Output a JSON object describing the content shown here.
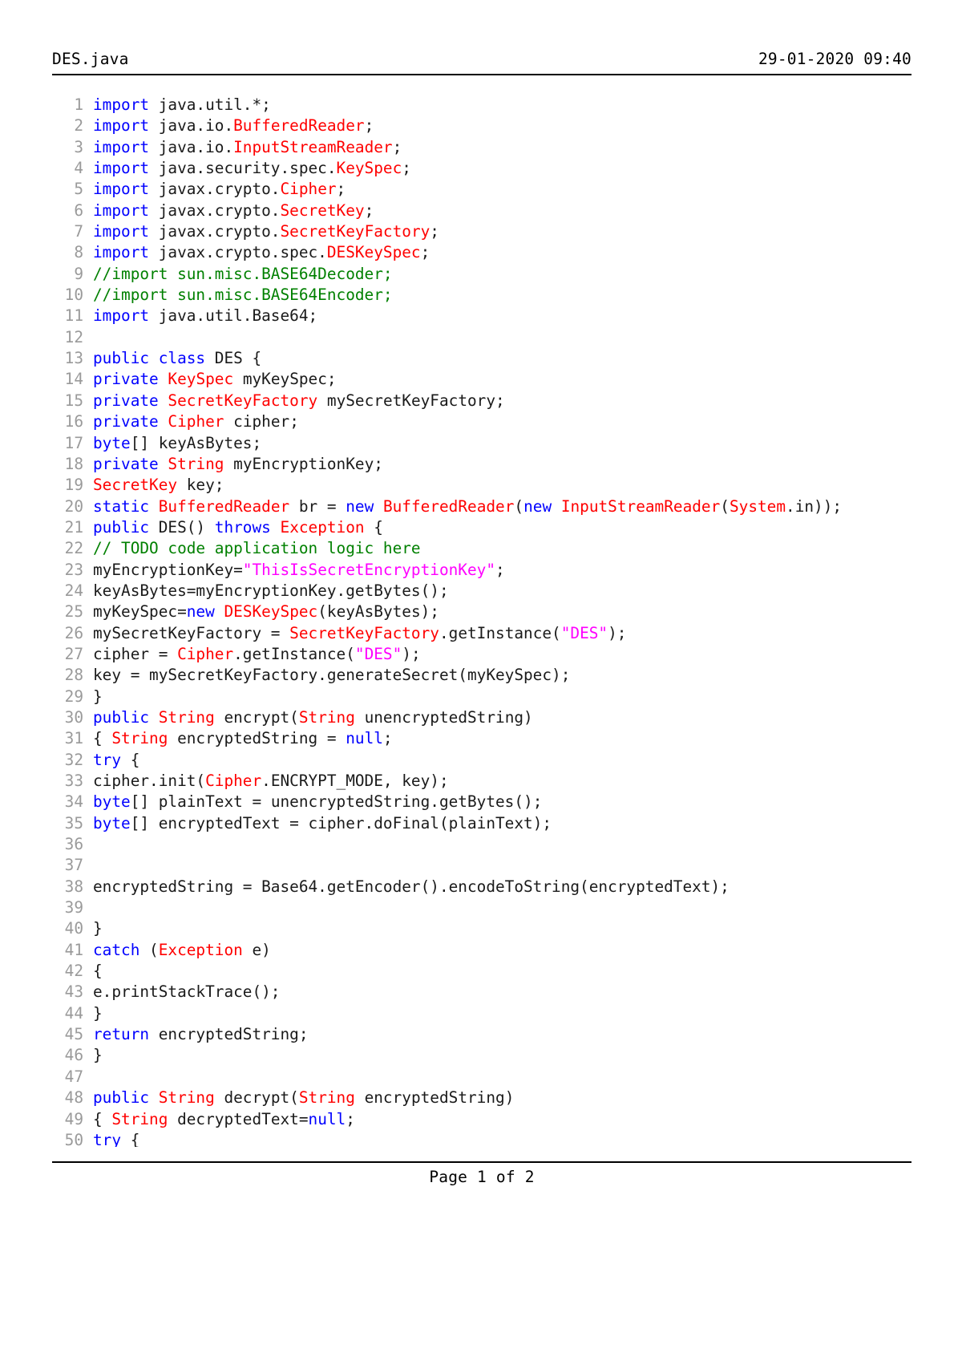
{
  "document": {
    "header": {
      "filename": "DES.java",
      "date": "29-01-2020",
      "time": "09:40",
      "datetime": "29-01-2020 09:40"
    },
    "footer": {
      "page_label": "Page 1 of 2",
      "current_page": 1,
      "total_pages": 2
    },
    "syntax_colors": {
      "keyword": "#0000ff",
      "class_name": "#ff0000",
      "string": "#ff00ff",
      "comment": "#008000",
      "plain": "#1a1a1a",
      "line_number": "#9a9a9a",
      "background": "#ffffff",
      "rule": "#000000"
    },
    "code_lines": [
      {
        "n": "1",
        "tokens": [
          {
            "t": "import",
            "c": "kw"
          },
          {
            "t": " java.util.*;",
            "c": "pln"
          }
        ]
      },
      {
        "n": "2",
        "tokens": [
          {
            "t": "import",
            "c": "kw"
          },
          {
            "t": " java.io.",
            "c": "pln"
          },
          {
            "t": "BufferedReader",
            "c": "cls"
          },
          {
            "t": ";",
            "c": "pln"
          }
        ]
      },
      {
        "n": "3",
        "tokens": [
          {
            "t": "import",
            "c": "kw"
          },
          {
            "t": " java.io.",
            "c": "pln"
          },
          {
            "t": "InputStreamReader",
            "c": "cls"
          },
          {
            "t": ";",
            "c": "pln"
          }
        ]
      },
      {
        "n": "4",
        "tokens": [
          {
            "t": "import",
            "c": "kw"
          },
          {
            "t": " java.security.spec.",
            "c": "pln"
          },
          {
            "t": "KeySpec",
            "c": "cls"
          },
          {
            "t": ";",
            "c": "pln"
          }
        ]
      },
      {
        "n": "5",
        "tokens": [
          {
            "t": "import",
            "c": "kw"
          },
          {
            "t": " javax.crypto.",
            "c": "pln"
          },
          {
            "t": "Cipher",
            "c": "cls"
          },
          {
            "t": ";",
            "c": "pln"
          }
        ]
      },
      {
        "n": "6",
        "tokens": [
          {
            "t": "import",
            "c": "kw"
          },
          {
            "t": " javax.crypto.",
            "c": "pln"
          },
          {
            "t": "SecretKey",
            "c": "cls"
          },
          {
            "t": ";",
            "c": "pln"
          }
        ]
      },
      {
        "n": "7",
        "tokens": [
          {
            "t": "import",
            "c": "kw"
          },
          {
            "t": " javax.crypto.",
            "c": "pln"
          },
          {
            "t": "SecretKeyFactory",
            "c": "cls"
          },
          {
            "t": ";",
            "c": "pln"
          }
        ]
      },
      {
        "n": "8",
        "tokens": [
          {
            "t": "import",
            "c": "kw"
          },
          {
            "t": " javax.crypto.spec.",
            "c": "pln"
          },
          {
            "t": "DESKeySpec",
            "c": "cls"
          },
          {
            "t": ";",
            "c": "pln"
          }
        ]
      },
      {
        "n": "9",
        "tokens": [
          {
            "t": "//import sun.misc.BASE64Decoder;",
            "c": "cmt"
          }
        ]
      },
      {
        "n": "10",
        "tokens": [
          {
            "t": "//import sun.misc.BASE64Encoder;",
            "c": "cmt"
          }
        ]
      },
      {
        "n": "11",
        "tokens": [
          {
            "t": "import",
            "c": "kw"
          },
          {
            "t": " java.util.Base64;",
            "c": "pln"
          }
        ]
      },
      {
        "n": "12",
        "tokens": []
      },
      {
        "n": "13",
        "tokens": [
          {
            "t": "public class",
            "c": "kw"
          },
          {
            "t": " DES {",
            "c": "pln"
          }
        ]
      },
      {
        "n": "14",
        "tokens": [
          {
            "t": "private",
            "c": "kw"
          },
          {
            "t": " ",
            "c": "pln"
          },
          {
            "t": "KeySpec",
            "c": "cls"
          },
          {
            "t": " myKeySpec;",
            "c": "pln"
          }
        ]
      },
      {
        "n": "15",
        "tokens": [
          {
            "t": "private",
            "c": "kw"
          },
          {
            "t": " ",
            "c": "pln"
          },
          {
            "t": "SecretKeyFactory",
            "c": "cls"
          },
          {
            "t": " mySecretKeyFactory;",
            "c": "pln"
          }
        ]
      },
      {
        "n": "16",
        "tokens": [
          {
            "t": "private",
            "c": "kw"
          },
          {
            "t": " ",
            "c": "pln"
          },
          {
            "t": "Cipher",
            "c": "cls"
          },
          {
            "t": " cipher;",
            "c": "pln"
          }
        ]
      },
      {
        "n": "17",
        "tokens": [
          {
            "t": "byte",
            "c": "kw"
          },
          {
            "t": "[] keyAsBytes;",
            "c": "pln"
          }
        ]
      },
      {
        "n": "18",
        "tokens": [
          {
            "t": "private",
            "c": "kw"
          },
          {
            "t": " ",
            "c": "pln"
          },
          {
            "t": "String",
            "c": "cls"
          },
          {
            "t": " myEncryptionKey;",
            "c": "pln"
          }
        ]
      },
      {
        "n": "19",
        "tokens": [
          {
            "t": "SecretKey",
            "c": "cls"
          },
          {
            "t": " key;",
            "c": "pln"
          }
        ]
      },
      {
        "n": "20",
        "tokens": [
          {
            "t": "static",
            "c": "kw"
          },
          {
            "t": " ",
            "c": "pln"
          },
          {
            "t": "BufferedReader",
            "c": "cls"
          },
          {
            "t": " br = ",
            "c": "pln"
          },
          {
            "t": "new",
            "c": "kw"
          },
          {
            "t": " ",
            "c": "pln"
          },
          {
            "t": "BufferedReader",
            "c": "cls"
          },
          {
            "t": "(",
            "c": "pln"
          },
          {
            "t": "new",
            "c": "kw"
          },
          {
            "t": " ",
            "c": "pln"
          },
          {
            "t": "InputStreamReader",
            "c": "cls"
          },
          {
            "t": "(",
            "c": "pln"
          },
          {
            "t": "System",
            "c": "cls"
          },
          {
            "t": ".in));",
            "c": "pln"
          }
        ]
      },
      {
        "n": "21",
        "tokens": [
          {
            "t": "public",
            "c": "kw"
          },
          {
            "t": " DES() ",
            "c": "pln"
          },
          {
            "t": "throws",
            "c": "kw"
          },
          {
            "t": " ",
            "c": "pln"
          },
          {
            "t": "Exception",
            "c": "cls"
          },
          {
            "t": " {",
            "c": "pln"
          }
        ]
      },
      {
        "n": "22",
        "tokens": [
          {
            "t": "// TODO code application logic here",
            "c": "cmt"
          }
        ]
      },
      {
        "n": "23",
        "tokens": [
          {
            "t": "myEncryptionKey=",
            "c": "pln"
          },
          {
            "t": "\"ThisIsSecretEncryptionKey\"",
            "c": "str"
          },
          {
            "t": ";",
            "c": "pln"
          }
        ]
      },
      {
        "n": "24",
        "tokens": [
          {
            "t": "keyAsBytes=myEncryptionKey.getBytes();",
            "c": "pln"
          }
        ]
      },
      {
        "n": "25",
        "tokens": [
          {
            "t": "myKeySpec=",
            "c": "pln"
          },
          {
            "t": "new",
            "c": "kw"
          },
          {
            "t": " ",
            "c": "pln"
          },
          {
            "t": "DESKeySpec",
            "c": "cls"
          },
          {
            "t": "(keyAsBytes);",
            "c": "pln"
          }
        ]
      },
      {
        "n": "26",
        "tokens": [
          {
            "t": "mySecretKeyFactory = ",
            "c": "pln"
          },
          {
            "t": "SecretKeyFactory",
            "c": "cls"
          },
          {
            "t": ".getInstance(",
            "c": "pln"
          },
          {
            "t": "\"DES\"",
            "c": "str"
          },
          {
            "t": ");",
            "c": "pln"
          }
        ]
      },
      {
        "n": "27",
        "tokens": [
          {
            "t": "cipher = ",
            "c": "pln"
          },
          {
            "t": "Cipher",
            "c": "cls"
          },
          {
            "t": ".getInstance(",
            "c": "pln"
          },
          {
            "t": "\"DES\"",
            "c": "str"
          },
          {
            "t": ");",
            "c": "pln"
          }
        ]
      },
      {
        "n": "28",
        "tokens": [
          {
            "t": "key = mySecretKeyFactory.generateSecret(myKeySpec);",
            "c": "pln"
          }
        ]
      },
      {
        "n": "29",
        "tokens": [
          {
            "t": "}",
            "c": "pln"
          }
        ]
      },
      {
        "n": "30",
        "tokens": [
          {
            "t": "public",
            "c": "kw"
          },
          {
            "t": " ",
            "c": "pln"
          },
          {
            "t": "String",
            "c": "cls"
          },
          {
            "t": " encrypt(",
            "c": "pln"
          },
          {
            "t": "String",
            "c": "cls"
          },
          {
            "t": " unencryptedString)",
            "c": "pln"
          }
        ]
      },
      {
        "n": "31",
        "tokens": [
          {
            "t": "{ ",
            "c": "pln"
          },
          {
            "t": "String",
            "c": "cls"
          },
          {
            "t": " encryptedString = ",
            "c": "pln"
          },
          {
            "t": "null",
            "c": "kw"
          },
          {
            "t": ";",
            "c": "pln"
          }
        ]
      },
      {
        "n": "32",
        "tokens": [
          {
            "t": "try",
            "c": "kw"
          },
          {
            "t": " {",
            "c": "pln"
          }
        ]
      },
      {
        "n": "33",
        "tokens": [
          {
            "t": "cipher.init(",
            "c": "pln"
          },
          {
            "t": "Cipher",
            "c": "cls"
          },
          {
            "t": ".ENCRYPT_MODE, key);",
            "c": "pln"
          }
        ]
      },
      {
        "n": "34",
        "tokens": [
          {
            "t": "byte",
            "c": "kw"
          },
          {
            "t": "[] plainText = unencryptedString.getBytes();",
            "c": "pln"
          }
        ]
      },
      {
        "n": "35",
        "tokens": [
          {
            "t": "byte",
            "c": "kw"
          },
          {
            "t": "[] encryptedText = cipher.doFinal(plainText);",
            "c": "pln"
          }
        ]
      },
      {
        "n": "36",
        "tokens": []
      },
      {
        "n": "37",
        "tokens": []
      },
      {
        "n": "38",
        "tokens": [
          {
            "t": "encryptedString = Base64.getEncoder().encodeToString(encryptedText);",
            "c": "pln"
          }
        ]
      },
      {
        "n": "39",
        "tokens": []
      },
      {
        "n": "40",
        "tokens": [
          {
            "t": "}",
            "c": "pln"
          }
        ]
      },
      {
        "n": "41",
        "tokens": [
          {
            "t": "catch",
            "c": "kw"
          },
          {
            "t": " (",
            "c": "pln"
          },
          {
            "t": "Exception",
            "c": "cls"
          },
          {
            "t": " e)",
            "c": "pln"
          }
        ]
      },
      {
        "n": "42",
        "tokens": [
          {
            "t": "{",
            "c": "pln"
          }
        ]
      },
      {
        "n": "43",
        "tokens": [
          {
            "t": "e.printStackTrace();",
            "c": "pln"
          }
        ]
      },
      {
        "n": "44",
        "tokens": [
          {
            "t": "}",
            "c": "pln"
          }
        ]
      },
      {
        "n": "45",
        "tokens": [
          {
            "t": "return",
            "c": "kw"
          },
          {
            "t": " encryptedString;",
            "c": "pln"
          }
        ]
      },
      {
        "n": "46",
        "tokens": [
          {
            "t": "}",
            "c": "pln"
          }
        ]
      },
      {
        "n": "47",
        "tokens": []
      },
      {
        "n": "48",
        "tokens": [
          {
            "t": "public",
            "c": "kw"
          },
          {
            "t": " ",
            "c": "pln"
          },
          {
            "t": "String",
            "c": "cls"
          },
          {
            "t": " decrypt(",
            "c": "pln"
          },
          {
            "t": "String",
            "c": "cls"
          },
          {
            "t": " encryptedString)",
            "c": "pln"
          }
        ]
      },
      {
        "n": "49",
        "tokens": [
          {
            "t": "{ ",
            "c": "pln"
          },
          {
            "t": "String",
            "c": "cls"
          },
          {
            "t": " decryptedText=",
            "c": "pln"
          },
          {
            "t": "null",
            "c": "kw"
          },
          {
            "t": ";",
            "c": "pln"
          }
        ]
      },
      {
        "n": "50",
        "tokens": [
          {
            "t": "try",
            "c": "kw"
          },
          {
            "t": " {",
            "c": "pln"
          }
        ]
      }
    ]
  }
}
